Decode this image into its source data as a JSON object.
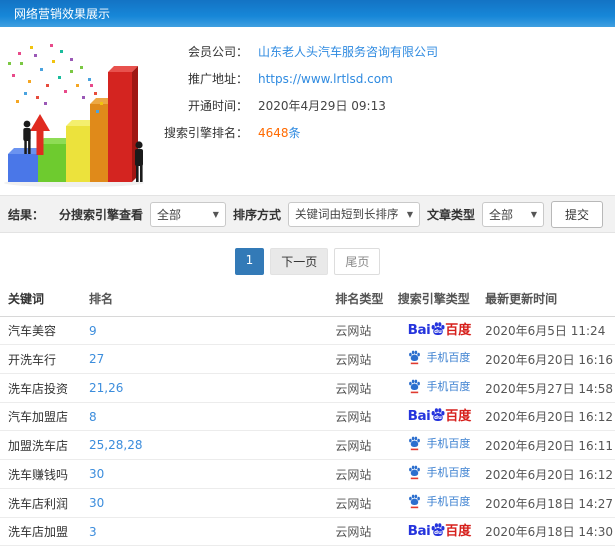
{
  "header": {
    "title": "网络营销效果展示"
  },
  "info": {
    "rows": [
      {
        "label": "会员公司：",
        "value": "山东老人头汽车服务咨询有限公司"
      },
      {
        "label": "推广地址：",
        "value": "https://www.lrtlsd.com"
      },
      {
        "label": "开通时间：",
        "value": "2020年4月29日 09:13"
      },
      {
        "label": "搜索引擎排名：",
        "value": "4648",
        "suffix": "条"
      }
    ]
  },
  "filters": {
    "result_label": "结果：",
    "engine_label": "分搜索引擎查看",
    "engine_value": "全部",
    "sort_label": "排序方式",
    "sort_value": "关键词由短到长排序",
    "article_label": "文章类型",
    "article_value": "全部",
    "submit_label": "提交",
    "caret": "▼"
  },
  "pagination": {
    "current": "1",
    "next": "下一页",
    "last": "尾页"
  },
  "table": {
    "headers": [
      "关键词",
      "排名",
      "排名类型",
      "搜索引擎类型",
      "最新更新时间"
    ],
    "engine_labels": {
      "bai": "Bai",
      "baidu_cn": "百度",
      "mobile": "手机百度"
    },
    "rows": [
      {
        "keyword": "汽车美容",
        "rank": "9",
        "rank_type": "云网站",
        "engine": "baidu",
        "updated": "2020年6月5日 11:24"
      },
      {
        "keyword": "开洗车行",
        "rank": "27",
        "rank_type": "云网站",
        "engine": "mobile-baidu",
        "updated": "2020年6月20日 16:16"
      },
      {
        "keyword": "洗车店投资",
        "rank": "21,26",
        "rank_type": "云网站",
        "engine": "mobile-baidu",
        "updated": "2020年5月27日 14:58"
      },
      {
        "keyword": "汽车加盟店",
        "rank": "8",
        "rank_type": "云网站",
        "engine": "baidu",
        "updated": "2020年6月20日 16:12"
      },
      {
        "keyword": "加盟洗车店",
        "rank": "25,28,28",
        "rank_type": "云网站",
        "engine": "mobile-baidu",
        "updated": "2020年6月20日 16:11"
      },
      {
        "keyword": "洗车赚钱吗",
        "rank": "30",
        "rank_type": "云网站",
        "engine": "mobile-baidu",
        "updated": "2020年6月20日 16:12"
      },
      {
        "keyword": "洗车店利润",
        "rank": "30",
        "rank_type": "云网站",
        "engine": "mobile-baidu",
        "updated": "2020年6月18日 14:27"
      },
      {
        "keyword": "洗车店加盟",
        "rank": "3",
        "rank_type": "云网站",
        "engine": "baidu",
        "updated": "2020年6月18日 14:30"
      }
    ]
  },
  "colors": {
    "header_blue": "#1787d8",
    "link_blue": "#2e8ae0",
    "highlight_orange": "#ff6a00",
    "baidu_blue": "#2534dd",
    "baidu_red": "#d6201c",
    "mobile_baidu_blue": "#3a7fd0",
    "pagination_active": "#337ab7"
  }
}
